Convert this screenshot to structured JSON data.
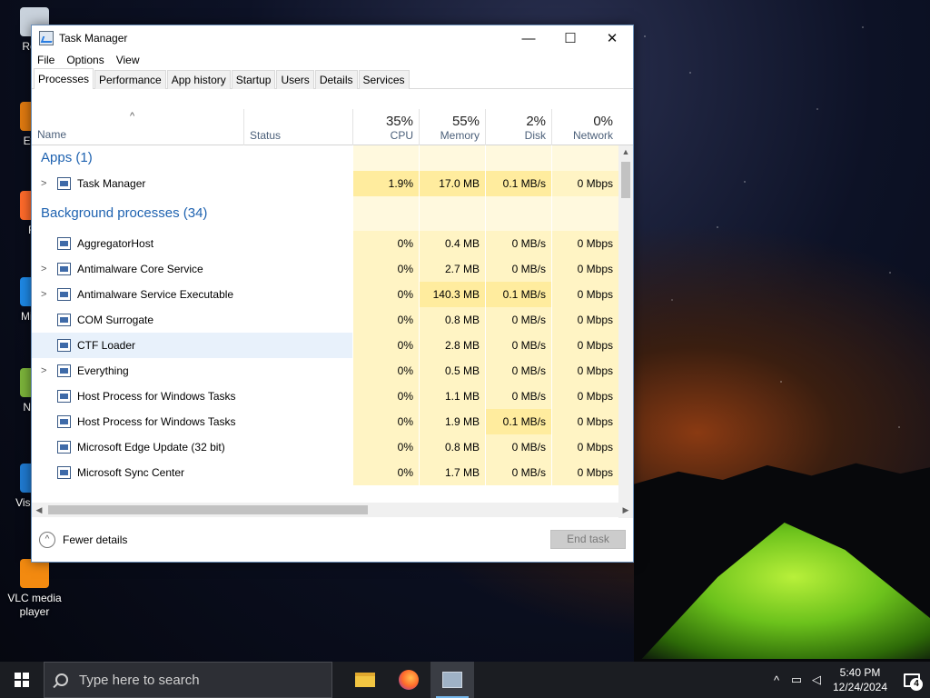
{
  "desktop": {
    "icons": [
      {
        "label": "Recy",
        "color": "#c9d2dc"
      },
      {
        "label": "Ever",
        "color": "#e07a10"
      },
      {
        "label": "Fir",
        "color": "#ff6a2a"
      },
      {
        "label": "Mic E",
        "color": "#1e88e5"
      },
      {
        "label": "Note",
        "color": "#7bb33a"
      },
      {
        "label": "Visua C",
        "color": "#1f7ad0"
      },
      {
        "label": "VLC media player",
        "color": "#f38a10"
      }
    ]
  },
  "window": {
    "title": "Task Manager",
    "controls": {
      "minimize": "—",
      "maximize": "☐",
      "close": "✕"
    },
    "menu": [
      "File",
      "Options",
      "View"
    ],
    "tabs": [
      "Processes",
      "Performance",
      "App history",
      "Startup",
      "Users",
      "Details",
      "Services"
    ],
    "active_tab": "Processes",
    "columns": {
      "name": "Name",
      "status": "Status",
      "cpu": {
        "pct": "35%",
        "label": "CPU"
      },
      "memory": {
        "pct": "55%",
        "label": "Memory"
      },
      "disk": {
        "pct": "2%",
        "label": "Disk"
      },
      "network": {
        "pct": "0%",
        "label": "Network"
      }
    },
    "groups": {
      "apps": "Apps (1)",
      "background": "Background processes (34)"
    },
    "apps": [
      {
        "name": "Task Manager",
        "cpu": "1.9%",
        "memory": "17.0 MB",
        "disk": "0.1 MB/s",
        "network": "0 Mbps",
        "expandable": true
      }
    ],
    "processes": [
      {
        "name": "AggregatorHost",
        "cpu": "0%",
        "memory": "0.4 MB",
        "disk": "0 MB/s",
        "network": "0 Mbps",
        "expandable": false
      },
      {
        "name": "Antimalware Core Service",
        "cpu": "0%",
        "memory": "2.7 MB",
        "disk": "0 MB/s",
        "network": "0 Mbps",
        "expandable": true
      },
      {
        "name": "Antimalware Service Executable",
        "cpu": "0%",
        "memory": "140.3 MB",
        "disk": "0.1 MB/s",
        "network": "0 Mbps",
        "expandable": true
      },
      {
        "name": "COM Surrogate",
        "cpu": "0%",
        "memory": "0.8 MB",
        "disk": "0 MB/s",
        "network": "0 Mbps",
        "expandable": false
      },
      {
        "name": "CTF Loader",
        "cpu": "0%",
        "memory": "2.8 MB",
        "disk": "0 MB/s",
        "network": "0 Mbps",
        "expandable": false
      },
      {
        "name": "Everything",
        "cpu": "0%",
        "memory": "0.5 MB",
        "disk": "0 MB/s",
        "network": "0 Mbps",
        "expandable": true
      },
      {
        "name": "Host Process for Windows Tasks",
        "cpu": "0%",
        "memory": "1.1 MB",
        "disk": "0 MB/s",
        "network": "0 Mbps",
        "expandable": false
      },
      {
        "name": "Host Process for Windows Tasks",
        "cpu": "0%",
        "memory": "1.9 MB",
        "disk": "0.1 MB/s",
        "network": "0 Mbps",
        "expandable": false
      },
      {
        "name": "Microsoft Edge Update (32 bit)",
        "cpu": "0%",
        "memory": "0.8 MB",
        "disk": "0 MB/s",
        "network": "0 Mbps",
        "expandable": false
      },
      {
        "name": "Microsoft Sync Center",
        "cpu": "0%",
        "memory": "1.7 MB",
        "disk": "0 MB/s",
        "network": "0 Mbps",
        "expandable": false
      }
    ],
    "footer": {
      "fewer_details": "Fewer details",
      "end_task": "End task"
    }
  },
  "taskbar": {
    "search_placeholder": "Type here to search",
    "clock_time": "5:40 PM",
    "clock_date": "12/24/2024",
    "notification_count": "4"
  }
}
